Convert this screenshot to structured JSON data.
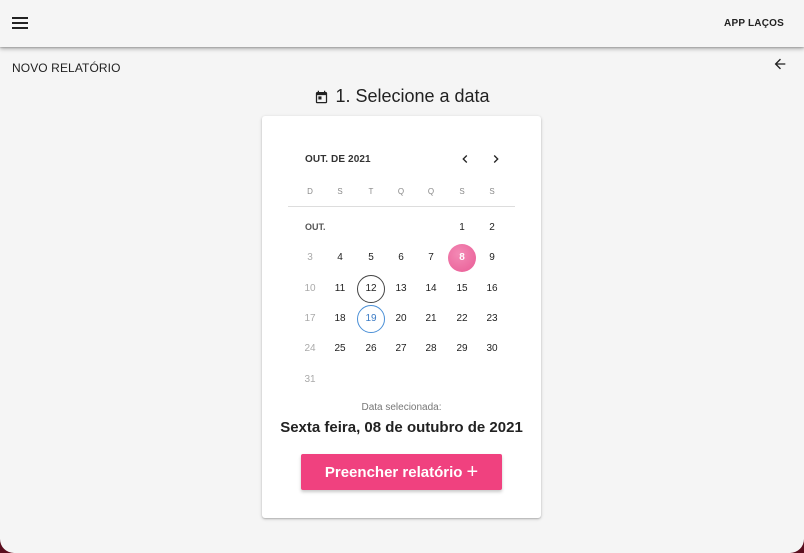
{
  "toolbar": {
    "menu_icon": "menu-icon",
    "app_title": "APP LAÇOS"
  },
  "header": {
    "page_title": "NOVO RELATÓRIO",
    "back_icon": "arrow-left-icon"
  },
  "step": {
    "icon": "calendar-icon",
    "title": "1. Selecione a data"
  },
  "calendar": {
    "month_label": "OUT. DE 2021",
    "inline_month": "OUT.",
    "weekdays": [
      "D",
      "S",
      "T",
      "Q",
      "Q",
      "S",
      "S"
    ],
    "selected_day": "8",
    "today_day": "12",
    "highlighted_day": "19",
    "accent_color": "#e95b95",
    "days": [
      "1",
      "2",
      "3",
      "4",
      "5",
      "6",
      "7",
      "8",
      "9",
      "10",
      "11",
      "12",
      "13",
      "14",
      "15",
      "16",
      "17",
      "18",
      "19",
      "20",
      "21",
      "22",
      "23",
      "24",
      "25",
      "26",
      "27",
      "28",
      "29",
      "30",
      "31"
    ]
  },
  "selection": {
    "label": "Data selecionada:",
    "date_text": "Sexta feira, 08 de outubro de 2021"
  },
  "action": {
    "button_label": "Preencher relatório",
    "button_icon": "+",
    "button_color": "#f0417f"
  }
}
